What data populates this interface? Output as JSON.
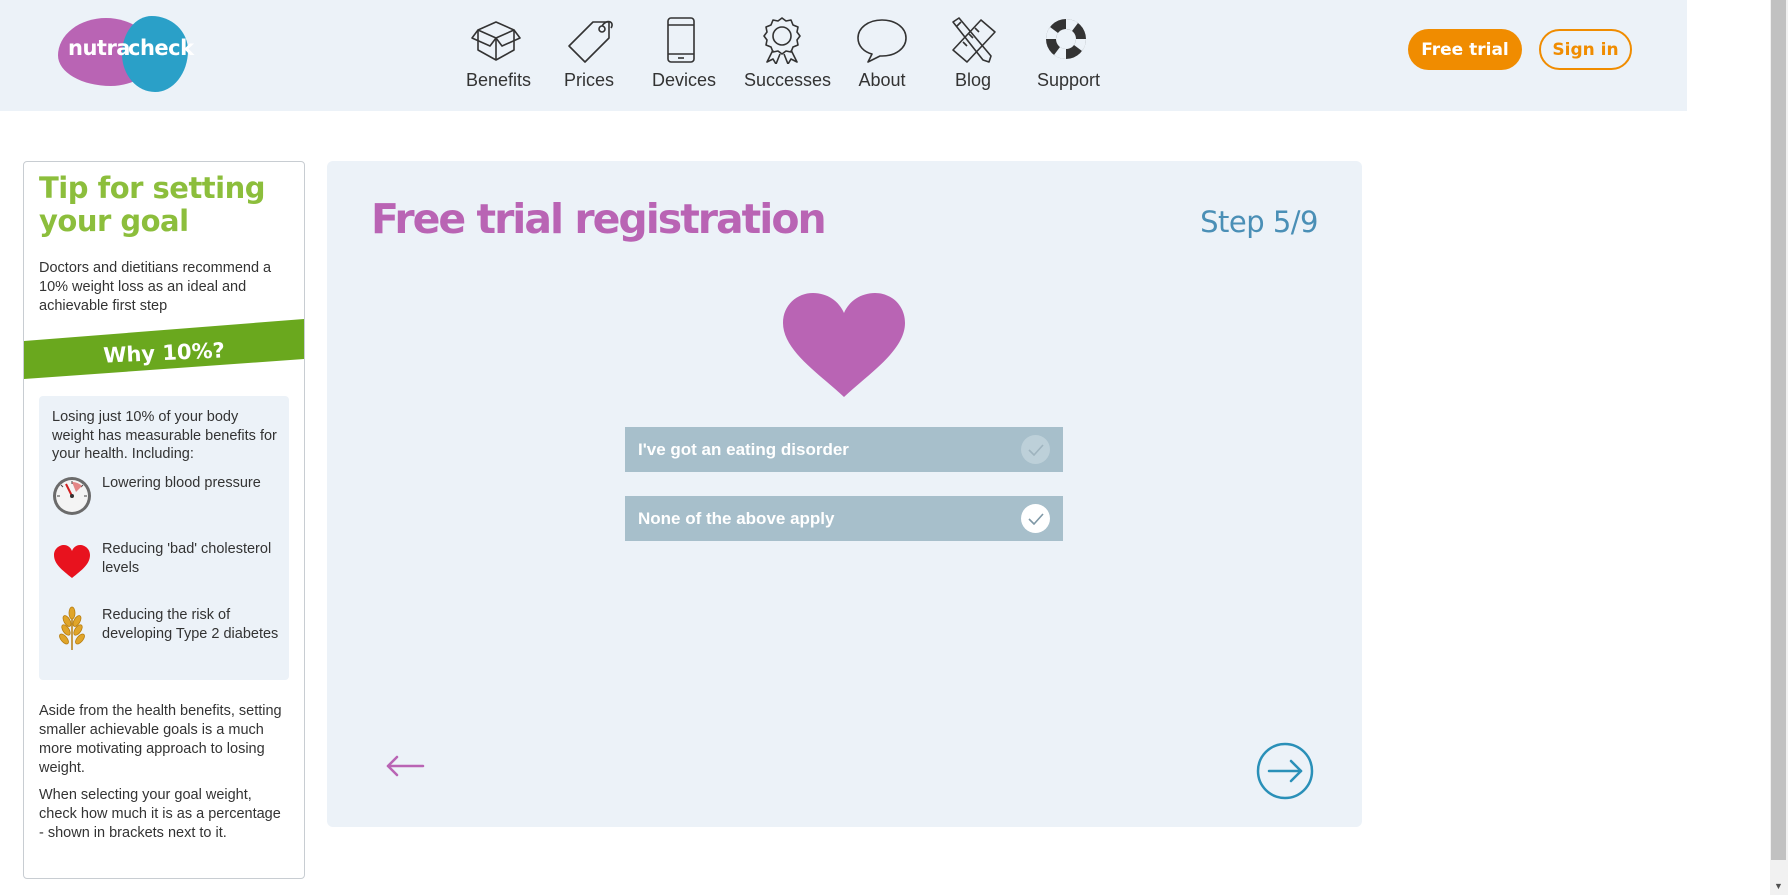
{
  "header": {
    "logo": {
      "word1": "nutra",
      "word2": "check"
    },
    "nav": [
      {
        "label": "Benefits",
        "icon": "box-icon"
      },
      {
        "label": "Prices",
        "icon": "price-tag-icon"
      },
      {
        "label": "Devices",
        "icon": "phone-icon"
      },
      {
        "label": "Successes",
        "icon": "award-rosette-icon"
      },
      {
        "label": "About",
        "icon": "speech-bubble-icon"
      },
      {
        "label": "Blog",
        "icon": "pencil-ruler-icon"
      },
      {
        "label": "Support",
        "icon": "lifebuoy-icon"
      }
    ],
    "free_trial_label": "Free trial",
    "sign_in_label": "Sign in"
  },
  "sidebar": {
    "title": "Tip for setting your goal",
    "intro": "Doctors and dietitians recommend a 10% weight loss as an ideal and achievable first step",
    "why_label": "Why 10%?",
    "benefits_intro": "Losing just 10% of your body weight has measurable benefits for your health. Including:",
    "benefits": [
      {
        "text": "Lowering blood pressure",
        "icon": "blood-pressure-gauge-icon"
      },
      {
        "text": "Reducing 'bad' cholesterol levels",
        "icon": "heart-icon"
      },
      {
        "text": "Reducing the risk of developing Type 2 diabetes",
        "icon": "wheat-icon"
      }
    ],
    "aside_1": "Aside from the health benefits, setting smaller achievable goals is a much more motivating approach to losing weight.",
    "aside_2": "When selecting your goal weight, check how much it is as a percentage - shown in brackets next to it."
  },
  "main": {
    "title": "Free trial registration",
    "step": "Step 5/9",
    "options": [
      {
        "label": "I've got an eating disorder",
        "checked": false
      },
      {
        "label": "None of the above apply",
        "checked": true
      }
    ]
  },
  "colors": {
    "brand_purple": "#b964b4",
    "brand_blue": "#2aa0c8",
    "accent_orange": "#f08c00",
    "tip_green": "#8cbe3c",
    "band_green": "#6aa81e",
    "panel_bg": "#ecf2f8",
    "option_bg": "#a7bfcb"
  }
}
